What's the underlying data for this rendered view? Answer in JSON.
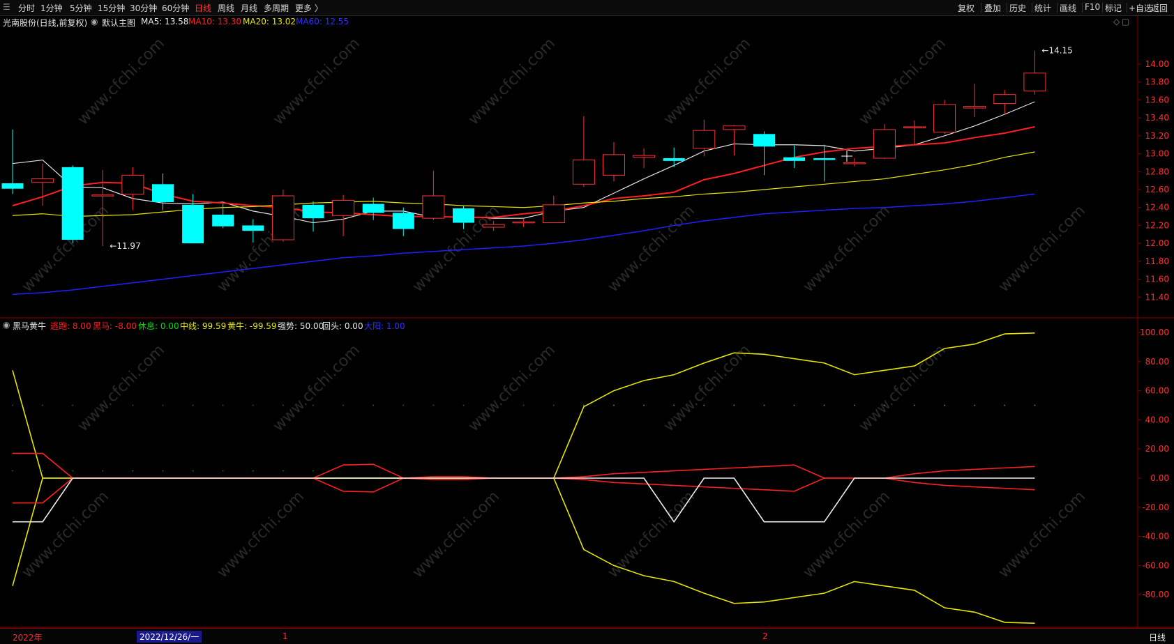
{
  "toolbar": {
    "items": [
      "分时",
      "1分钟",
      "5分钟",
      "15分钟",
      "30分钟",
      "60分钟",
      "日线",
      "周线",
      "月线",
      "多周期",
      "更多 〉"
    ],
    "active": "日线",
    "right_items": [
      "复权",
      "叠加",
      "历史",
      "统计",
      "画线",
      "F10",
      "标记",
      "+自选",
      "返回"
    ]
  },
  "main_info": {
    "stock": "光南股份(日线,前复权)",
    "indicator": "默认主图",
    "ma5": "MA5: 13.58",
    "ma10": "MA10: 13.30",
    "ma20": "MA20: 13.02",
    "ma60": "MA60: 12.55",
    "high_label": "14.15",
    "low_label": "11.97"
  },
  "sub_info": {
    "name": "黑马黄牛",
    "f1": "逃跑: 8.00",
    "f2": "黑马: -8.00",
    "f3": "休息: 0.00",
    "f4": "中线: 99.59",
    "f5": "黄牛: -99.59",
    "f6": "强势: 50.00",
    "f7": "回头: 0.00",
    "f8": "大阳: 1.00"
  },
  "watermark": "www.cfchi.com",
  "bottom": {
    "year": "2022年",
    "cursor_date": "2022/12/26/一",
    "m1": "1",
    "m2": "2",
    "period": "日线"
  },
  "colors": {
    "up": "#ff3232",
    "down": "#00ffff",
    "ma5": "#e6e6e6",
    "ma10": "#ff2020",
    "ma20": "#e6e600",
    "ma60": "#2020ff"
  },
  "chart_data": [
    {
      "type": "candlestick",
      "title": "光南股份(日线,前复权)",
      "y_ticks": [
        14.0,
        13.8,
        13.6,
        13.4,
        13.2,
        13.0,
        12.8,
        12.6,
        12.4,
        12.2,
        12.0,
        11.8,
        11.6,
        11.4
      ],
      "ylim": [
        11.34,
        14.28
      ],
      "candles": [
        {
          "o": 12.67,
          "c": 12.61,
          "h": 13.27,
          "l": 12.55
        },
        {
          "o": 12.68,
          "c": 12.72,
          "h": 12.89,
          "l": 12.42
        },
        {
          "o": 12.85,
          "c": 12.04,
          "h": 12.87,
          "l": 12.0
        },
        {
          "o": 12.53,
          "c": 12.54,
          "h": 12.82,
          "l": 11.97
        },
        {
          "o": 12.55,
          "c": 12.76,
          "h": 12.85,
          "l": 12.37
        },
        {
          "o": 12.66,
          "c": 12.46,
          "h": 12.78,
          "l": 12.37
        },
        {
          "o": 12.43,
          "c": 12.0,
          "h": 12.55,
          "l": 12.0
        },
        {
          "o": 12.32,
          "c": 12.19,
          "h": 12.44,
          "l": 12.17
        },
        {
          "o": 12.2,
          "c": 12.14,
          "h": 12.27,
          "l": 12.01
        },
        {
          "o": 12.04,
          "c": 12.53,
          "h": 12.6,
          "l": 12.02
        },
        {
          "o": 12.43,
          "c": 12.28,
          "h": 12.47,
          "l": 12.13
        },
        {
          "o": 12.31,
          "c": 12.48,
          "h": 12.54,
          "l": 12.08
        },
        {
          "o": 12.44,
          "c": 12.34,
          "h": 12.51,
          "l": 12.26
        },
        {
          "o": 12.34,
          "c": 12.16,
          "h": 12.4,
          "l": 12.08
        },
        {
          "o": 12.28,
          "c": 12.53,
          "h": 12.81,
          "l": 12.26
        },
        {
          "o": 12.39,
          "c": 12.23,
          "h": 12.42,
          "l": 12.16
        },
        {
          "o": 12.18,
          "c": 12.21,
          "h": 12.25,
          "l": 12.14
        },
        {
          "o": 12.23,
          "c": 12.24,
          "h": 12.27,
          "l": 12.18
        },
        {
          "o": 12.23,
          "c": 12.43,
          "h": 12.53,
          "l": 12.23
        },
        {
          "o": 12.66,
          "c": 12.93,
          "h": 13.42,
          "l": 12.63
        },
        {
          "o": 12.76,
          "c": 12.99,
          "h": 13.13,
          "l": 12.69
        },
        {
          "o": 12.96,
          "c": 12.98,
          "h": 13.06,
          "l": 12.84
        },
        {
          "o": 12.95,
          "c": 12.92,
          "h": 13.07,
          "l": 12.85
        },
        {
          "o": 13.06,
          "c": 13.26,
          "h": 13.38,
          "l": 12.97
        },
        {
          "o": 13.27,
          "c": 13.31,
          "h": 13.32,
          "l": 12.98
        },
        {
          "o": 13.22,
          "c": 13.08,
          "h": 13.25,
          "l": 12.76
        },
        {
          "o": 12.96,
          "c": 12.92,
          "h": 13.09,
          "l": 12.84
        },
        {
          "o": 12.95,
          "c": 12.93,
          "h": 13.1,
          "l": 12.69
        },
        {
          "o": 12.9,
          "c": 12.9,
          "h": 12.95,
          "l": 12.86
        },
        {
          "o": 12.95,
          "c": 13.27,
          "h": 13.33,
          "l": 12.94
        },
        {
          "o": 13.3,
          "c": 13.3,
          "h": 13.37,
          "l": 13.1
        },
        {
          "o": 13.24,
          "c": 13.55,
          "h": 13.6,
          "l": 13.22
        },
        {
          "o": 13.51,
          "c": 13.53,
          "h": 13.78,
          "l": 13.41
        },
        {
          "o": 13.56,
          "c": 13.66,
          "h": 13.71,
          "l": 13.44
        },
        {
          "o": 13.7,
          "c": 13.9,
          "h": 14.15,
          "l": 13.66
        }
      ],
      "series": [
        {
          "name": "MA5: 13.58",
          "values": [
            12.89,
            12.93,
            12.63,
            12.62,
            12.5,
            12.45,
            12.44,
            12.46,
            12.36,
            12.3,
            12.23,
            12.27,
            12.36,
            12.36,
            12.29,
            12.3,
            12.28,
            12.28,
            12.36,
            12.4,
            12.56,
            12.72,
            12.87,
            13.03,
            13.11,
            13.1,
            13.1,
            13.09,
            13.03,
            13.06,
            13.1,
            13.2,
            13.31,
            13.44,
            13.58
          ]
        },
        {
          "name": "MA10: 13.30",
          "values": [
            12.42,
            12.52,
            12.64,
            12.68,
            12.67,
            12.55,
            12.47,
            12.45,
            12.42,
            12.4,
            12.35,
            12.34,
            12.32,
            12.3,
            12.3,
            12.29,
            12.29,
            12.33,
            12.36,
            12.42,
            12.5,
            12.53,
            12.57,
            12.71,
            12.78,
            12.87,
            12.96,
            13.02,
            13.06,
            13.08,
            13.1,
            13.12,
            13.18,
            13.23,
            13.3
          ]
        },
        {
          "name": "MA20: 13.02",
          "values": [
            12.31,
            12.33,
            12.3,
            12.31,
            12.32,
            12.35,
            12.38,
            12.4,
            12.41,
            12.43,
            12.45,
            12.46,
            12.47,
            12.45,
            12.44,
            12.42,
            12.41,
            12.4,
            12.42,
            12.45,
            12.47,
            12.5,
            12.52,
            12.55,
            12.57,
            12.6,
            12.63,
            12.66,
            12.69,
            12.72,
            12.77,
            12.82,
            12.88,
            12.96,
            13.02
          ]
        },
        {
          "name": "MA60: 12.55",
          "values": [
            11.43,
            11.45,
            11.48,
            11.52,
            11.56,
            11.6,
            11.64,
            11.68,
            11.72,
            11.76,
            11.8,
            11.84,
            11.86,
            11.89,
            11.91,
            11.93,
            11.95,
            11.97,
            12.0,
            12.04,
            12.09,
            12.14,
            12.2,
            12.25,
            12.29,
            12.33,
            12.35,
            12.37,
            12.39,
            12.4,
            12.42,
            12.44,
            12.47,
            12.51,
            12.55
          ]
        }
      ],
      "annotations": [
        {
          "text": "14.15",
          "index": 34,
          "value": 14.15
        },
        {
          "text": "11.97",
          "index": 3,
          "value": 11.97
        }
      ]
    },
    {
      "type": "line",
      "title": "黑马黄牛",
      "y_ticks": [
        100.0,
        80.0,
        60.0,
        40.0,
        20.0,
        0.0,
        -20.0,
        -40.0,
        -60.0,
        -80.0
      ],
      "ylim": [
        -100,
        100
      ],
      "series": [
        {
          "name": "中线",
          "values": [
            74,
            0,
            0,
            0,
            0,
            0,
            0,
            0,
            0,
            0,
            0,
            0,
            0,
            0,
            0,
            0,
            0,
            0,
            0,
            49,
            60,
            67,
            71,
            79,
            86,
            85,
            82,
            79,
            71,
            74,
            77,
            89,
            92,
            99,
            99.59
          ]
        },
        {
          "name": "黄牛",
          "values": [
            -74,
            0,
            0,
            0,
            0,
            0,
            0,
            0,
            0,
            0,
            0,
            0,
            0,
            0,
            0,
            0,
            0,
            0,
            0,
            -49,
            -60,
            -67,
            -71,
            -79,
            -86,
            -85,
            -82,
            -79,
            -71,
            -74,
            -77,
            -89,
            -92,
            -99,
            -99.59
          ]
        },
        {
          "name": "逃跑",
          "values": [
            17,
            17,
            0,
            0,
            0,
            0,
            0,
            0,
            0,
            0,
            0,
            9,
            9.5,
            0,
            1,
            1,
            0,
            0,
            0,
            1,
            3,
            4,
            5,
            6,
            7,
            8,
            9,
            0,
            0,
            0,
            3,
            5,
            6,
            7,
            8
          ]
        },
        {
          "name": "黑马",
          "values": [
            -17,
            -17,
            0,
            0,
            0,
            0,
            0,
            0,
            0,
            0,
            0,
            -9,
            -9.5,
            0,
            -1,
            -1,
            0,
            0,
            0,
            -1,
            -3,
            -4,
            -5,
            -6,
            -7,
            -8,
            -9,
            0,
            0,
            0,
            -3,
            -5,
            -6,
            -7,
            -8
          ]
        },
        {
          "name": "强势",
          "values": [
            -30,
            -30,
            0,
            0,
            0,
            0,
            0,
            0,
            0,
            0,
            0,
            0,
            0,
            0,
            0,
            0,
            0,
            0,
            0,
            0,
            0,
            0,
            -30,
            0,
            0,
            -30,
            -30,
            -30,
            0,
            0,
            0,
            0,
            0,
            0,
            0
          ]
        }
      ]
    }
  ]
}
